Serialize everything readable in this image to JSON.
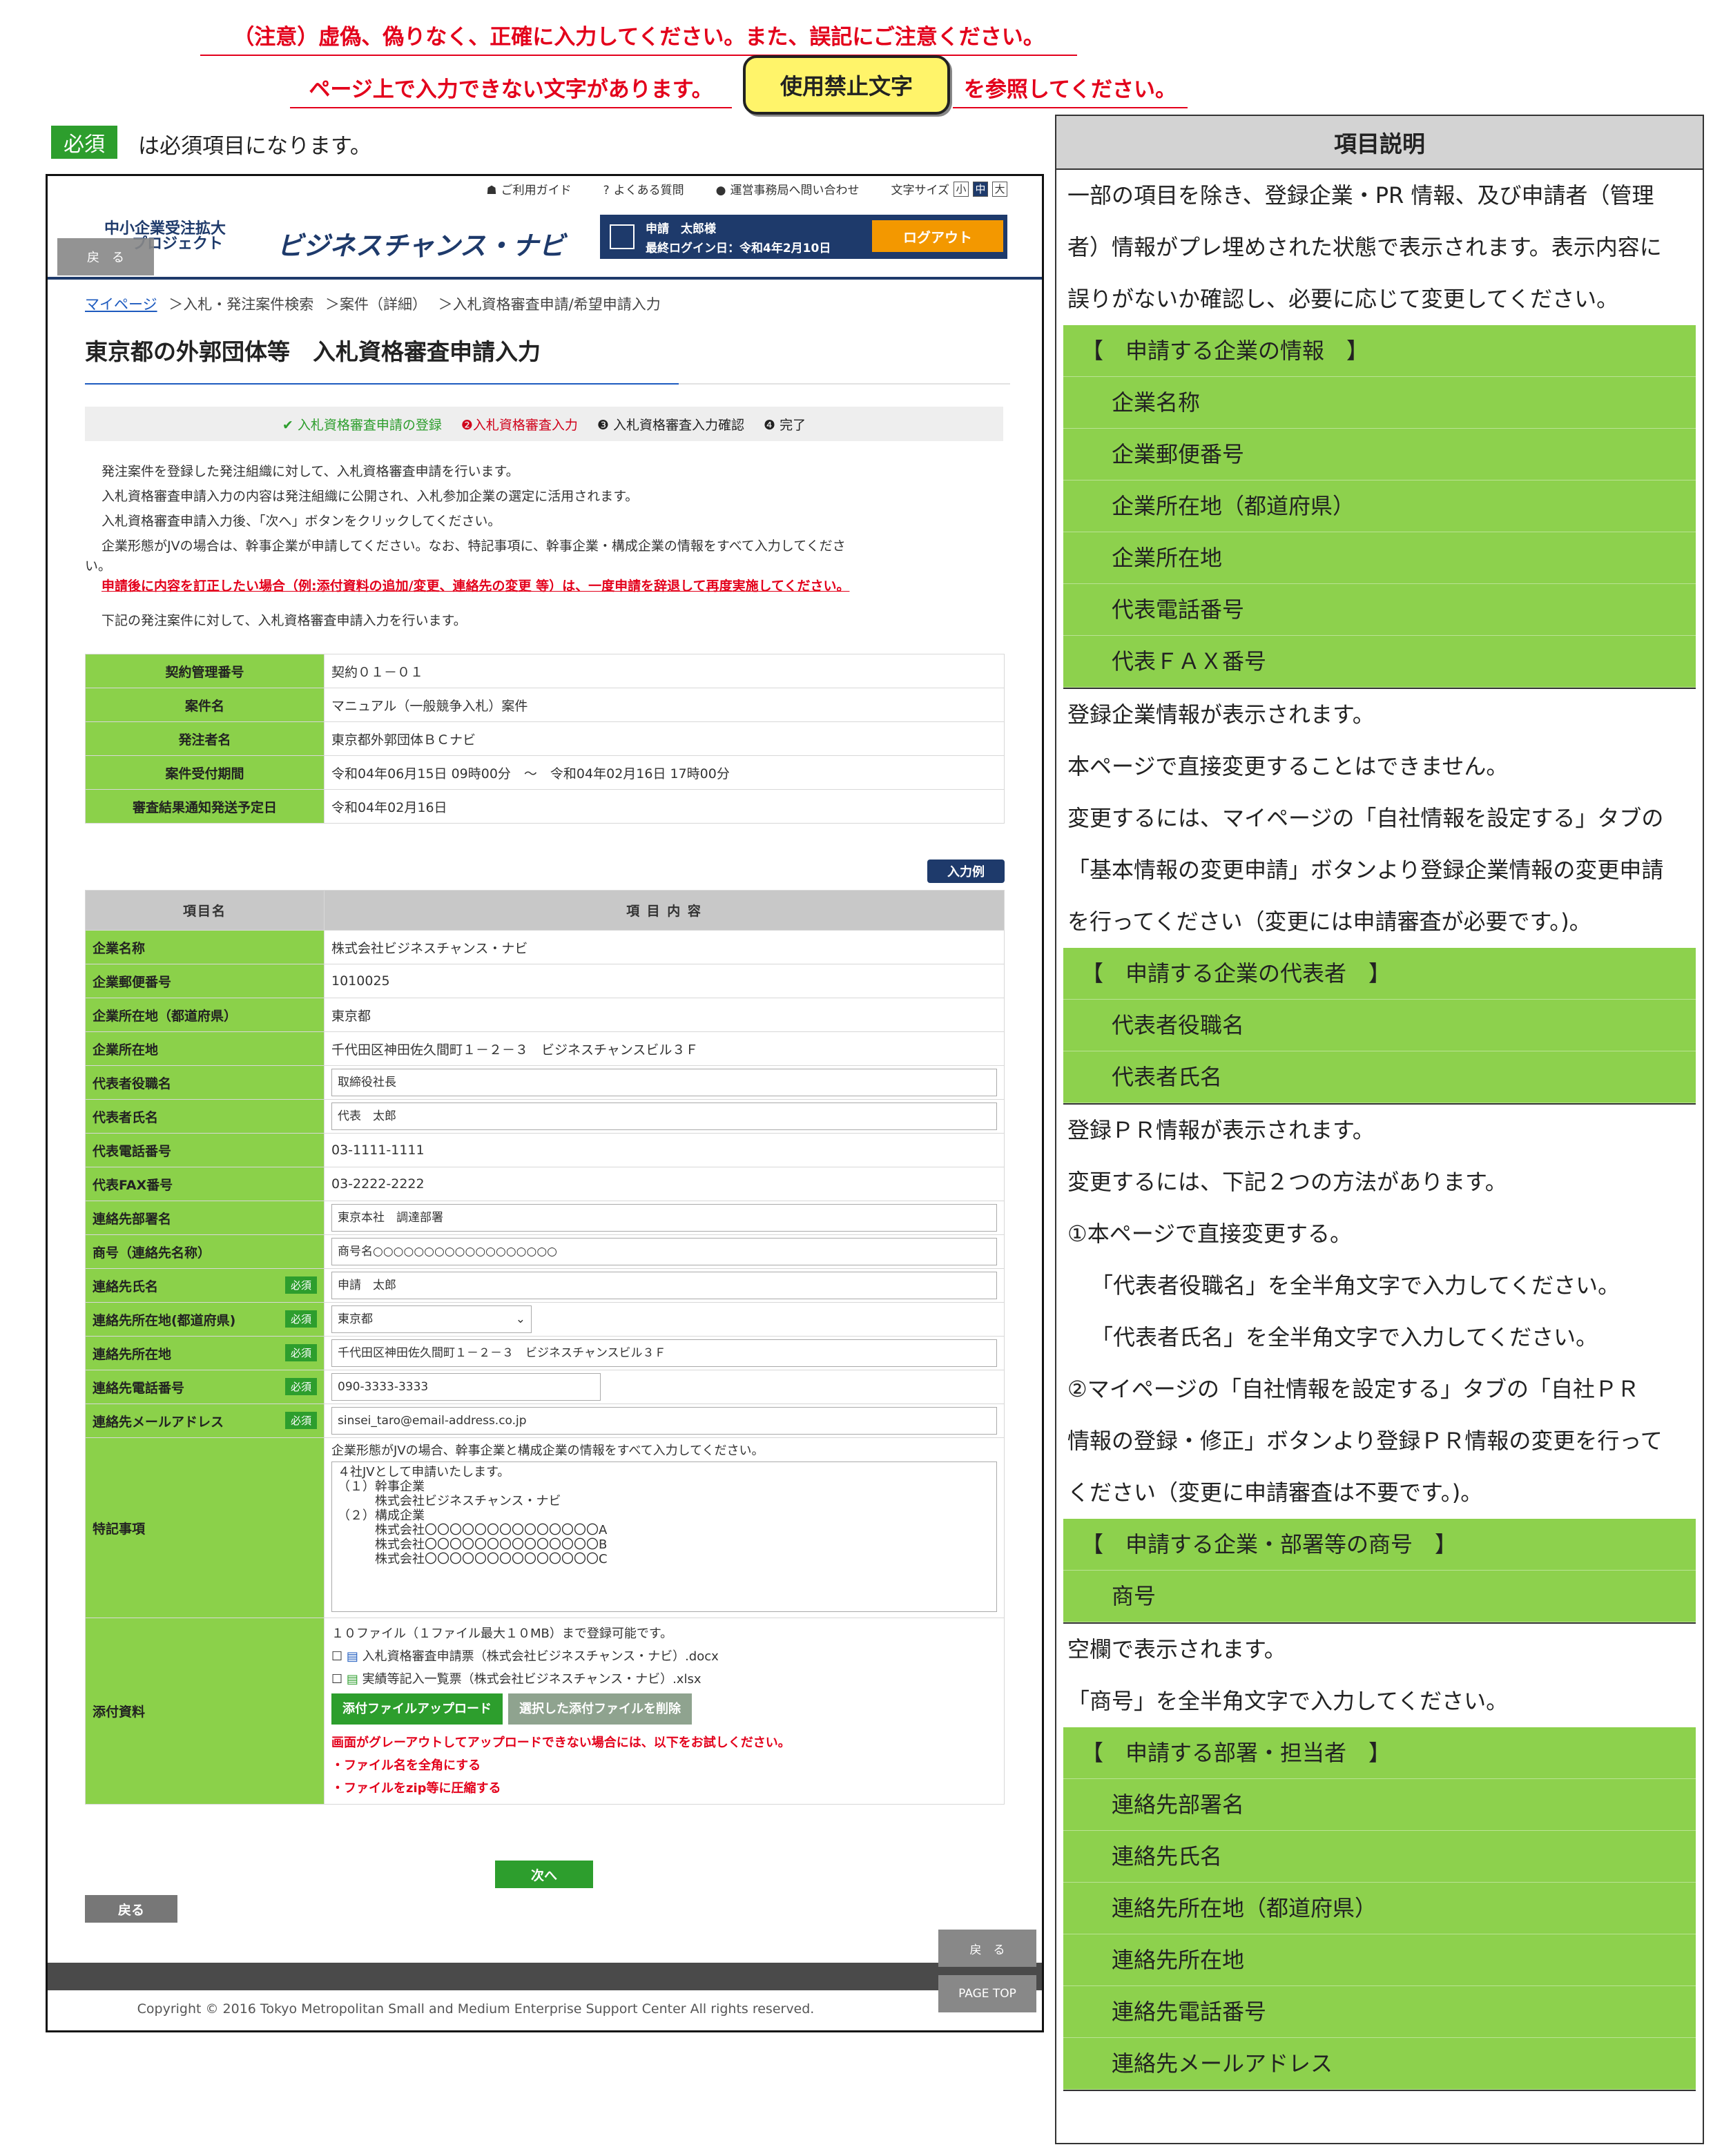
{
  "notices": {
    "line1": "（注意）虚偽、偽りなく、正確に入力してください。また、誤記にご注意ください。",
    "line2a": "ページ上で入力できない文字があります。",
    "banned_button": "使用禁止文字",
    "line2b": "を参照してください。",
    "required_badge": "必須",
    "required_text": "は必須項目になります。"
  },
  "shot": {
    "util": {
      "guide": "ご利用ガイド",
      "faq": "よくある質問",
      "contact": "運営事務局へ問い合わせ",
      "font_size": "文字サイズ",
      "small": "小",
      "medium": "中",
      "large": "大"
    },
    "logo_sub_1": "中小企業受注拡大",
    "logo_sub_2": "プロジェクト",
    "logo_main": "ビジネスチャンス・ナビ",
    "user_name": "申請　太郎様",
    "last_login": "最終ログイン日：令和4年2月10日",
    "logout": "ログアウト",
    "back": "戻　る",
    "breadcrumb": {
      "mypage": "マイページ",
      "c1": "＞入札・発注案件検索",
      "c2": "＞案件（詳細）",
      "c3": "＞入札資格審査申請/希望申請入力"
    },
    "page_title": "東京都の外郭団体等　入札資格審査申請入力",
    "steps": [
      "✔ 入札資格審査申請の登録",
      "❷入札資格審査入力",
      "❸ 入札資格審査入力確認",
      "❹ 完了"
    ],
    "intro": [
      "発注案件を登録した発注組織に対して、入札資格審査申請を行います。",
      "入札資格審査申請入力の内容は発注組織に公開され、入札参加企業の選定に活用されます。",
      "入札資格審査申請入力後、「次へ」ボタンをクリックしてください。",
      "企業形態がJVの場合は、幹事企業が申請してください。なお、特記事項に、幹事企業・構成企業の情報をすべて入力してくださ",
      "い。"
    ],
    "warning": "申請後に内容を訂正したい場合（例:添付資料の追加/変更、連絡先の変更 等）は、一度申請を辞退して再度実施してください。",
    "lead": "下記の発注案件に対して、入札資格審査申請入力を行います。",
    "case_rows": [
      {
        "k": "契約管理番号",
        "v": "契約０１－０１"
      },
      {
        "k": "案件名",
        "v": "マニュアル（一般競争入札）案件"
      },
      {
        "k": "発注者名",
        "v": "東京都外郭団体ＢＣナビ"
      },
      {
        "k": "案件受付期間",
        "v": "令和04年06月15日 09時00分　～　令和04年02月16日 17時00分"
      },
      {
        "k": "審査結果通知発送予定日",
        "v": "令和04年02月16日"
      }
    ],
    "example_btn": "入力例",
    "form_head": {
      "k": "項目名",
      "v": "項 目 内 容"
    },
    "form_rows": [
      {
        "k": "企業名称",
        "v": "株式会社ビジネスチャンス・ナビ"
      },
      {
        "k": "企業郵便番号",
        "v": "1010025"
      },
      {
        "k": "企業所在地（都道府県）",
        "v": "東京都"
      },
      {
        "k": "企業所在地",
        "v": "千代田区神田佐久間町１－２－３　ビジネスチャンスビル３Ｆ"
      }
    ],
    "input_rows": [
      {
        "k": "代表者役職名",
        "v": "取締役社長"
      },
      {
        "k": "代表者氏名",
        "v": "代表　太郎"
      }
    ],
    "text_rows": [
      {
        "k": "代表電話番号",
        "v": "03-1111-1111"
      },
      {
        "k": "代表FAX番号",
        "v": "03-2222-2222"
      }
    ],
    "input_rows2": [
      {
        "k": "連絡先部署名",
        "v": "東京本社　調達部署"
      },
      {
        "k": "商号（連絡先名称）",
        "v": "商号名○○○○○○○○○○○○○○○○○○"
      }
    ],
    "req_label": "必須",
    "contact_name": {
      "k": "連絡先氏名",
      "v": "申請　太郎"
    },
    "contact_pref": {
      "k": "連絡先所在地(都道府県)",
      "v": "東京都"
    },
    "contact_addr": {
      "k": "連絡先所在地",
      "v": "千代田区神田佐久間町１－２－３　ビジネスチャンスビル３Ｆ"
    },
    "contact_tel": {
      "k": "連絡先電話番号",
      "v": "090-3333-3333"
    },
    "contact_mail": {
      "k": "連絡先メールアドレス",
      "v": "sinsei_taro@email-address.co.jp"
    },
    "remarks": {
      "k": "特記事項",
      "note": "企業形態がJVの場合、幹事企業と構成企業の情報をすべて入力してください。",
      "text": "４社JVとして申請いたします。\n（１）幹事企業\n　　　株式会社ビジネスチャンス・ナビ\n（２）構成企業\n　　　株式会社〇〇〇〇〇〇〇〇〇〇〇〇〇〇A\n　　　株式会社〇〇〇〇〇〇〇〇〇〇〇〇〇〇B\n　　　株式会社〇〇〇〇〇〇〇〇〇〇〇〇〇〇C"
    },
    "attach": {
      "k": "添付資料",
      "limit": "１０ファイル（１ファイル最大１０MB）まで登録可能です。",
      "file1": "入札資格審査申請票（株式会社ビジネスチャンス・ナビ）.docx",
      "file2": "実績等記入一覧票（株式会社ビジネスチャンス・ナビ）.xlsx",
      "upload": "添付ファイルアップロード",
      "delete": "選択した添付ファイルを削除",
      "hint1": "画面がグレーアウトしてアップロードできない場合には、以下をお試しください。",
      "hint2": "・ファイル名を全角にする",
      "hint3": "・ファイルをzip等に圧縮する"
    },
    "next": "次へ",
    "back_btn": "戻る",
    "float_back": "戻　る",
    "page_top": "PAGE TOP",
    "copyright": "Copyright © 2016 Tokyo Metropolitan Small and Medium Enterprise Support Center All rights reserved."
  },
  "side": {
    "title": "項目説明",
    "p1": [
      "一部の項目を除き、登録企業・PR 情報、及び申請者（管理",
      "者）情報がプレ埋めされた状態で表示されます。表示内容に",
      "誤りがないか確認し、必要に応じて変更してください。"
    ],
    "sec1": {
      "h": "【　申請する企業の情報　】",
      "items": [
        "企業名称",
        "企業郵便番号",
        "企業所在地（都道府県）",
        "企業所在地",
        "代表電話番号",
        "代表ＦＡＸ番号"
      ]
    },
    "p2": [
      "登録企業情報が表示されます。",
      "本ページで直接変更することはできません。",
      "変更するには、マイページの「自社情報を設定する」タブの",
      "「基本情報の変更申請」ボタンより登録企業情報の変更申請",
      "を行ってください（変更には申請審査が必要です。)。"
    ],
    "sec2": {
      "h": "【　申請する企業の代表者　】",
      "items": [
        "代表者役職名",
        "代表者氏名"
      ]
    },
    "p3": [
      "登録ＰＲ情報が表示されます。",
      "変更するには、下記２つの方法があります。",
      "①本ページで直接変更する。"
    ],
    "p3i": [
      "「代表者役職名」を全半角文字で入力してください。",
      "「代表者氏名」を全半角文字で入力してください。"
    ],
    "p3b": [
      "②マイページの「自社情報を設定する」タブの「自社ＰＲ",
      "情報の登録・修正」ボタンより登録ＰＲ情報の変更を行って",
      "ください（変更に申請審査は不要です。)。"
    ],
    "sec3": {
      "h": "【　申請する企業・部署等の商号　】",
      "items": [
        "商号"
      ]
    },
    "p4": [
      "空欄で表示されます。",
      "「商号」を全半角文字で入力してください。"
    ],
    "sec4": {
      "h": "【　申請する部署・担当者　】",
      "items": [
        "連絡先部署名",
        "連絡先氏名",
        "連絡先所在地（都道府県）",
        "連絡先所在地",
        "連絡先電話番号",
        "連絡先メールアドレス"
      ]
    }
  }
}
